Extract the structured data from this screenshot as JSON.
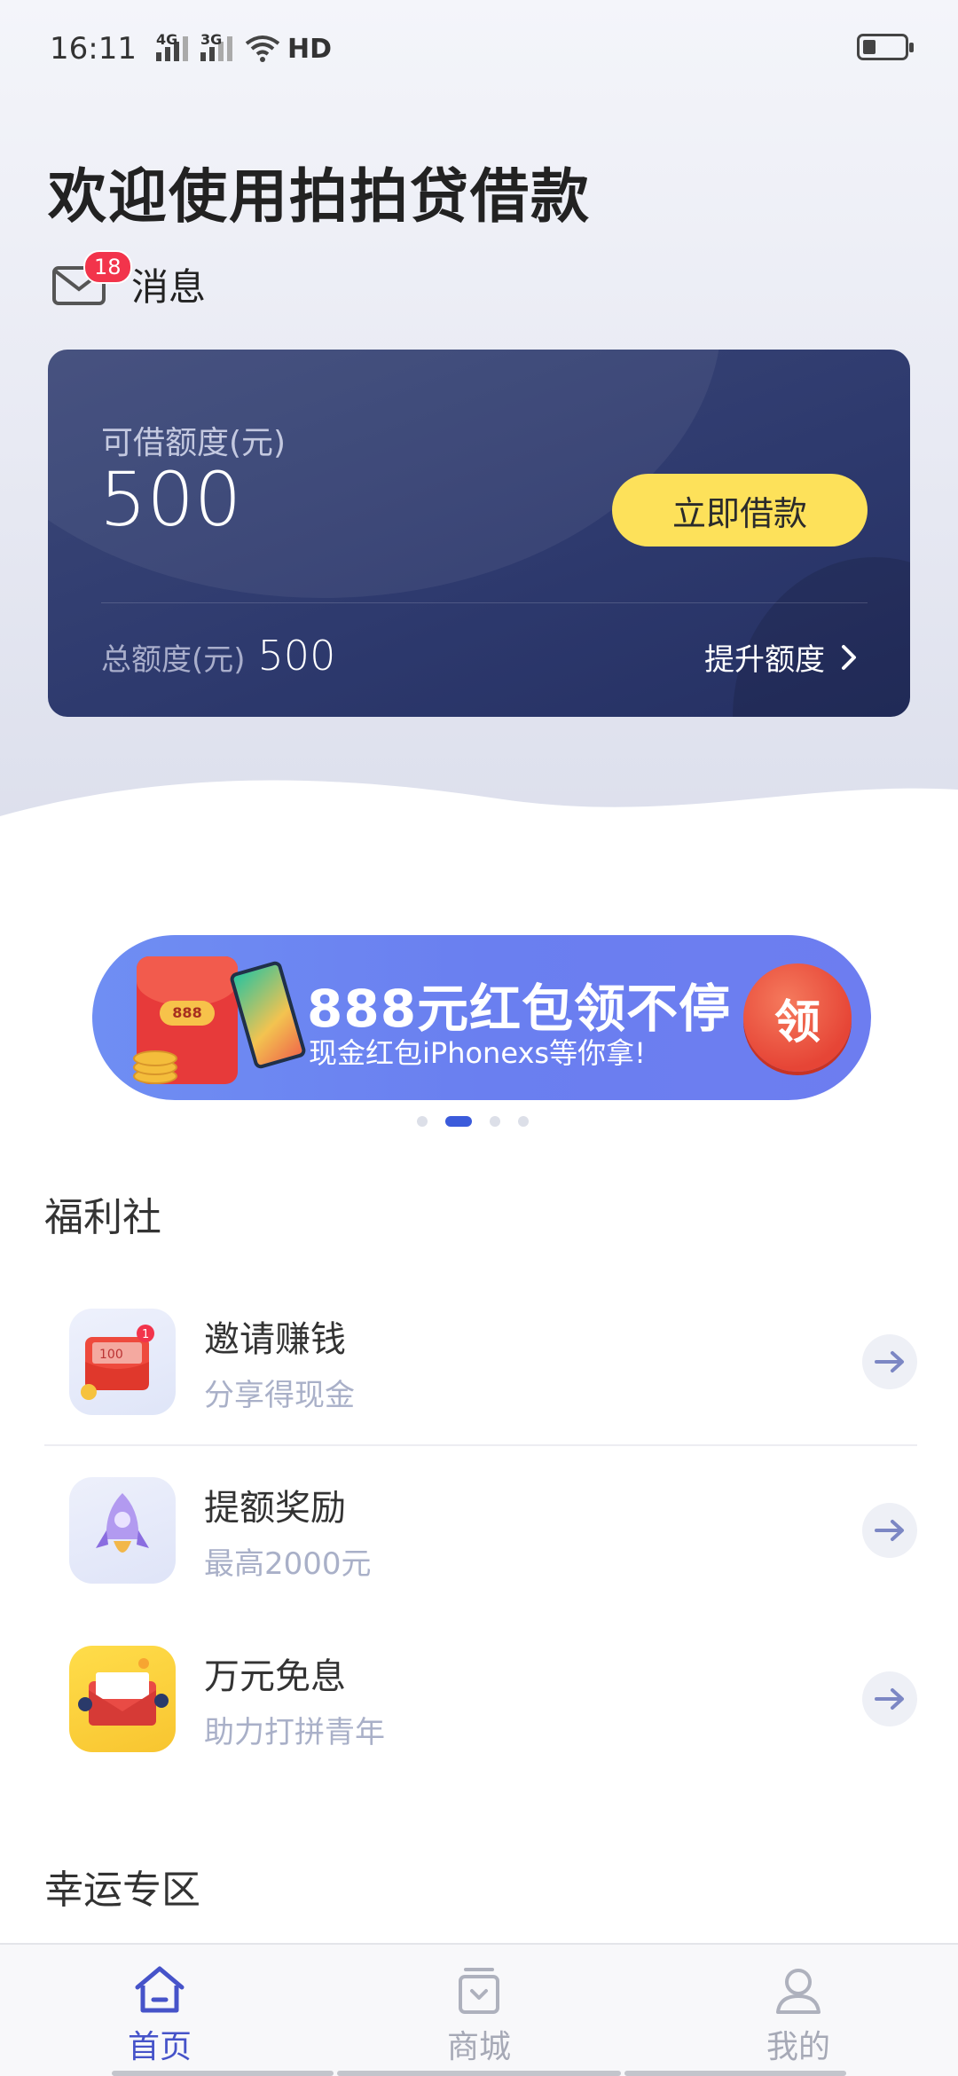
{
  "status_bar": {
    "time": "16:11",
    "signal1_label": "4G",
    "signal2_label": "3G",
    "hd_label": "HD"
  },
  "header": {
    "welcome": "欢迎使用拍拍贷借款",
    "messages_label": "消息",
    "messages_badge": "18"
  },
  "credit_card": {
    "available_label": "可借额度(元)",
    "available_value": "500",
    "borrow_button": "立即借款",
    "total_label": "总额度(元)",
    "total_value": "500",
    "raise_label": "提升额度"
  },
  "banner": {
    "envelope_number": "888",
    "title": "888元红包领不停",
    "subtitle": "现金红包iPhonexs等你拿!",
    "button": "领",
    "carousel_index": 2,
    "carousel_count": 4
  },
  "welfare": {
    "title": "福利社",
    "items": [
      {
        "title": "邀请赚钱",
        "subtitle": "分享得现金",
        "icon": "red-envelope-icon",
        "icon_badge": "1",
        "icon_note": "100"
      },
      {
        "title": "提额奖励",
        "subtitle": "最高2000元",
        "icon": "rocket-icon"
      },
      {
        "title": "万元免息",
        "subtitle": "助力打拼青年",
        "icon": "envelope-people-icon"
      }
    ]
  },
  "lucky": {
    "title": "幸运专区"
  },
  "tabbar": {
    "tabs": [
      {
        "label": "首页",
        "icon": "home-icon",
        "active": true
      },
      {
        "label": "商城",
        "icon": "shop-bag-icon",
        "active": false
      },
      {
        "label": "我的",
        "icon": "user-icon",
        "active": false
      }
    ]
  },
  "colors": {
    "accent": "#4653c9",
    "card_bg": "#2e3a6e",
    "button_yellow": "#fde15a",
    "badge_red": "#f2344b",
    "banner_blue": "#6a7ff0"
  }
}
